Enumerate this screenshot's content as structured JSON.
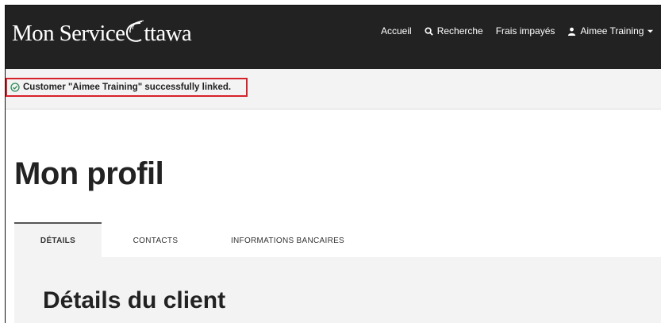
{
  "header": {
    "logo_text_left": "Mon Service",
    "logo_text_right": "ttawa",
    "background_color": "#222222"
  },
  "nav": {
    "home_label": "Accueil",
    "search_label": "Recherche",
    "search_icon": "search-icon",
    "fees_label": "Frais impayés",
    "user_label": "Aimee Training",
    "user_icon": "user-icon",
    "user_dropdown_icon": "chevron-down-icon"
  },
  "alert": {
    "message": "Customer \"Aimee Training\" successfully linked.",
    "icon": "check-circle-icon",
    "icon_color": "#2e8b57",
    "highlight_color": "#d6222a"
  },
  "page": {
    "title": "Mon profil"
  },
  "tabs": [
    {
      "label": "DÉTAILS",
      "active": true
    },
    {
      "label": "CONTACTS",
      "active": false
    },
    {
      "label": "INFORMATIONS BANCAIRES",
      "active": false
    }
  ],
  "content": {
    "section_title": "Détails du client"
  }
}
